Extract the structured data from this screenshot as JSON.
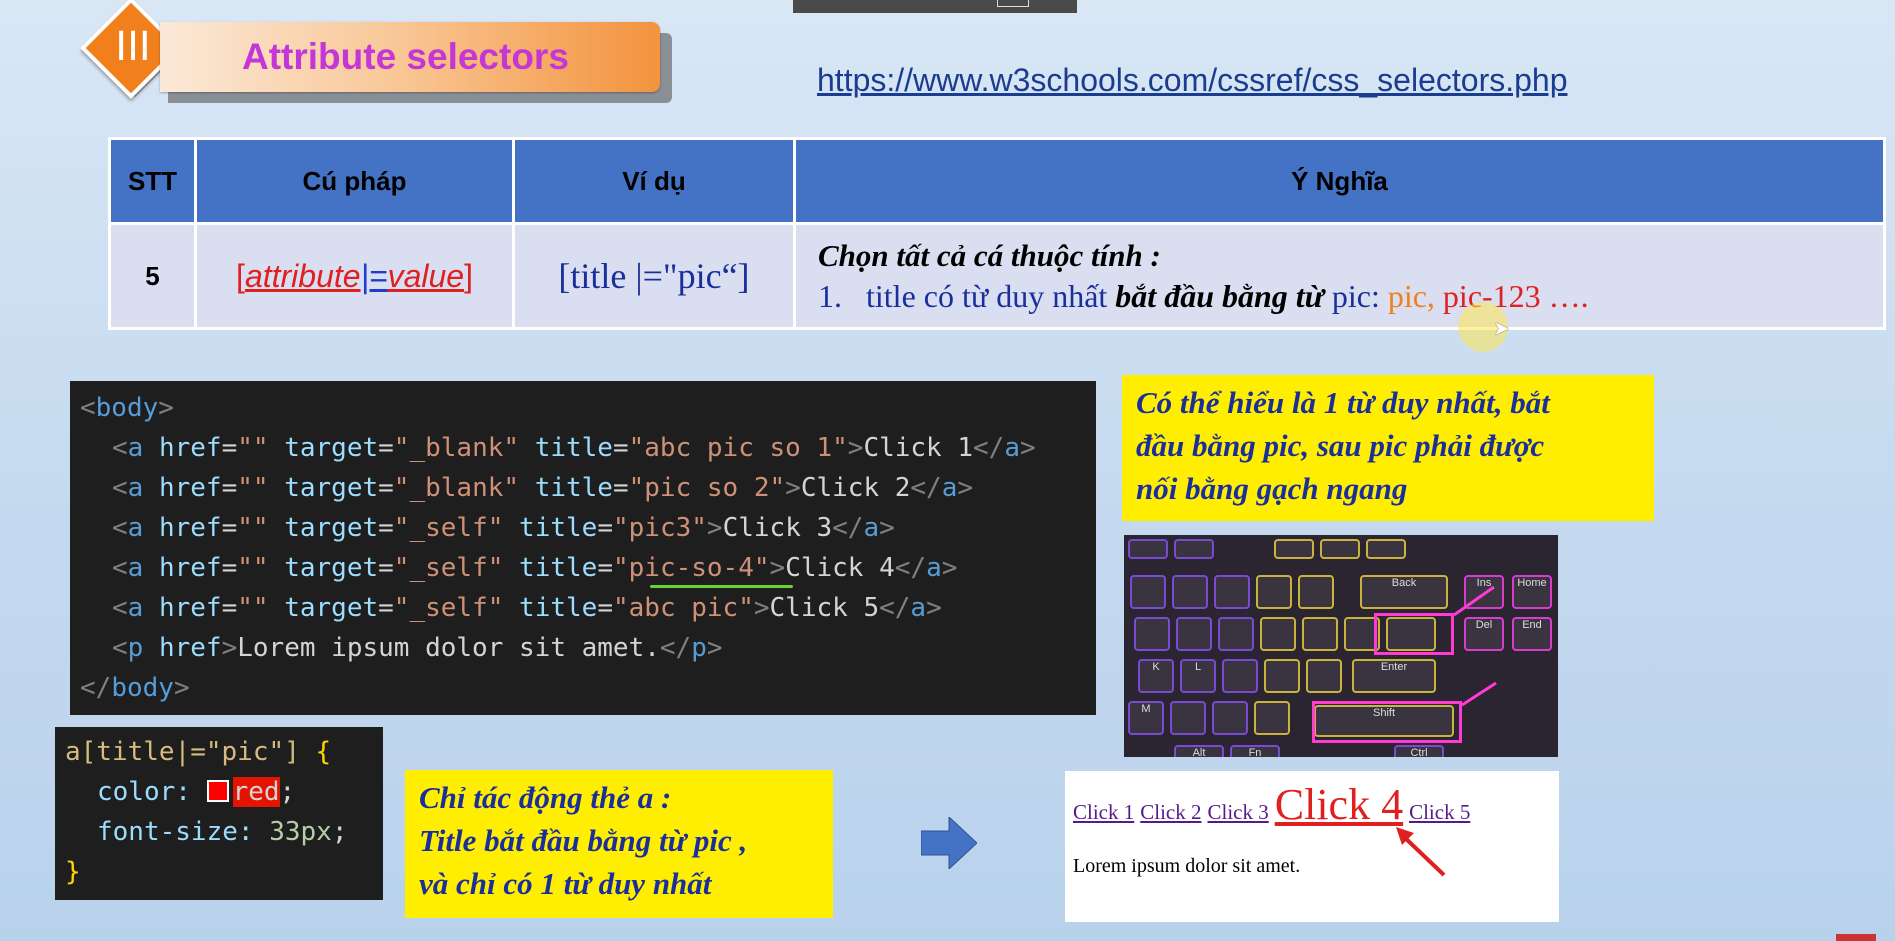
{
  "slide": {
    "section_number": "III",
    "title": "Attribute selectors",
    "link": "https://www.w3schools.com/cssref/css_selectors.php"
  },
  "table": {
    "headers": [
      "STT",
      "Cú pháp",
      "Ví dụ",
      "Ý Nghĩa"
    ],
    "row": {
      "stt": "5",
      "syntax_open": "[",
      "syntax_attr": "attribute",
      "syntax_op": "|=",
      "syntax_value": "value",
      "syntax_close": "]",
      "example": "[title |=\"pic“]",
      "meaning_line1": "Chọn tất cả cá thuộc tính :",
      "meaning_num": "1.",
      "meaning_a": "title có từ duy nhất ",
      "meaning_bold": "bắt đầu bằng từ",
      "meaning_b": " pic:  ",
      "meaning_pic": "pic,",
      "meaning_rest": " pic-123 …."
    }
  },
  "html_code": {
    "body_open": "<body>",
    "links": [
      {
        "target": "_blank",
        "title": "abc pic so 1",
        "text": "Click 1"
      },
      {
        "target": "_blank",
        "title": "pic so 2",
        "text": "Click 2"
      },
      {
        "target": "_self",
        "title": "pic3",
        "text": "Click 3"
      },
      {
        "target": "_self",
        "title": "pic-so-4",
        "text": "Click 4"
      },
      {
        "target": "_self",
        "title": "abc pic",
        "text": "Click 5"
      }
    ],
    "p_text": "Lorem ipsum dolor sit amet.",
    "body_close": "</body>"
  },
  "css_code": {
    "selector": "a[title|=\"pic\"] {",
    "color_prop": "color: ",
    "color_val": "red",
    "font_prop": "font-size: ",
    "font_val": "33px",
    "close": "}"
  },
  "notes": {
    "top_right": [
      "Có thể hiểu là 1 từ duy nhất, bắt",
      "đầu bằng pic, sau pic phải được",
      "nối bằng gạch ngang"
    ],
    "bottom_left": [
      "Chỉ tác động thẻ a :",
      "Title bắt đầu bằng từ pic ,",
      "và chỉ có 1 từ duy nhất"
    ]
  },
  "keyboard": {
    "keys": [
      "Back",
      "Enter",
      "Shift",
      "Ins",
      "Home",
      "Del",
      "End",
      "Ctrl",
      "Alt",
      "Fn",
      "M",
      "K",
      "L"
    ]
  },
  "browser_result": {
    "links": [
      "Click 1",
      "Click 2",
      "Click 3",
      "Click 4",
      "Click 5"
    ],
    "paragraph": "Lorem ipsum dolor sit amet."
  },
  "colors": {
    "header_blue": "#4472c4",
    "note_yellow": "#ffee00",
    "accent_orange": "#f07f1c",
    "title_magenta": "#c536d6"
  }
}
